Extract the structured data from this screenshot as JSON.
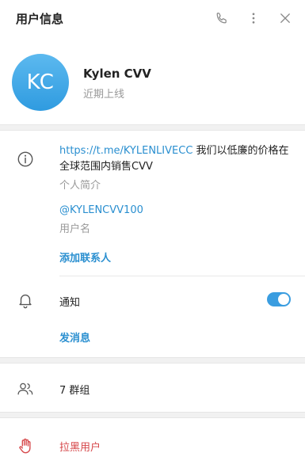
{
  "header": {
    "title": "用户信息",
    "icons": [
      "phone-icon",
      "more-vertical-icon",
      "close-icon"
    ]
  },
  "profile": {
    "initials": "KC",
    "name": "Kylen CVV",
    "status": "近期上线",
    "avatar_color": "#3aa6e6"
  },
  "info": {
    "bio_link": "https://t.me/KYLENLIVECC",
    "bio_text": " 我们以低廉的价格在全球范围内销售CVV",
    "bio_label": "个人简介",
    "username": "@KYLENCVV100",
    "username_label": "用户名",
    "add_contact": "添加联系人"
  },
  "notifications": {
    "label": "通知",
    "enabled": true,
    "send_message": "发消息"
  },
  "groups": {
    "label": "7 群组"
  },
  "block": {
    "label": "拉黑用户"
  },
  "colors": {
    "accent": "#2a8fd0",
    "danger": "#d6474a",
    "toggle_on": "#3a9de0"
  }
}
